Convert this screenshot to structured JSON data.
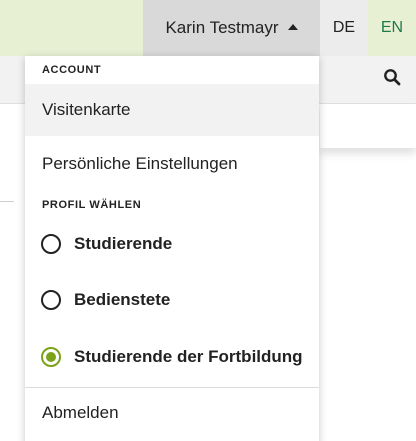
{
  "header": {
    "user_name": "Karin Testmayr",
    "languages": [
      {
        "code": "DE",
        "active": false
      },
      {
        "code": "EN",
        "active": true
      }
    ]
  },
  "menu": {
    "account_label": "ACCOUNT",
    "items": [
      {
        "label": "Visitenkarte",
        "active": true
      },
      {
        "label": "Persönliche Einstellungen",
        "active": false
      }
    ],
    "profile_label": "PROFIL WÄHLEN",
    "profiles": [
      {
        "label": "Studierende",
        "selected": false
      },
      {
        "label": "Bedienstete",
        "selected": false
      },
      {
        "label": "Studierende der Fortbildung",
        "selected": true
      }
    ],
    "logout_label": "Abmelden"
  },
  "colors": {
    "accent_green": "#7aa319",
    "highlight_bg": "#e8f0d4",
    "user_menu_bg": "#d9d9d9",
    "lang_active_text": "#1f7a4a"
  },
  "icons": {
    "user_menu_caret": "caret-up-icon",
    "search": "search-icon"
  }
}
